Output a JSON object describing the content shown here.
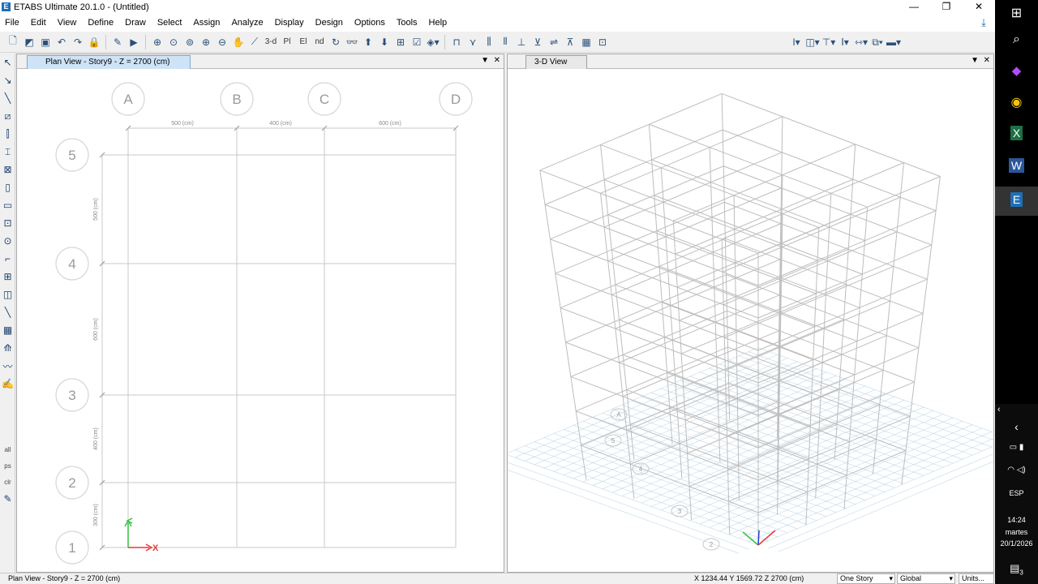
{
  "window": {
    "title": "ETABS Ultimate 20.1.0 - (Untitled)",
    "controls": [
      "—",
      "❐",
      "✕"
    ]
  },
  "menu": [
    "File",
    "Edit",
    "View",
    "Define",
    "Draw",
    "Select",
    "Assign",
    "Analyze",
    "Display",
    "Design",
    "Options",
    "Tools",
    "Help"
  ],
  "toolbar": {
    "view_3d_label": "3-d",
    "plan_label": "Pl",
    "elev_label": "El",
    "nd_label": "nd"
  },
  "plan_view": {
    "tab_title": "Plan View - Story9 - Z = 2700 (cm)",
    "grid_x": [
      "A",
      "B",
      "C",
      "D"
    ],
    "grid_y": [
      "5",
      "4",
      "3",
      "2",
      "1"
    ],
    "x_spacings": [
      "500 (cm)",
      "400 (cm)",
      "600 (cm)"
    ],
    "y_spacings": [
      "500 (cm)",
      "600 (cm)",
      "400 (cm)",
      "300 (cm)"
    ],
    "axis_x_label": "X"
  },
  "view_3d": {
    "tab_title": "3-D View",
    "bubbles": [
      "A",
      "5",
      "4",
      "3",
      "2"
    ]
  },
  "status": {
    "left": "Plan View - Story9 - Z = 2700 (cm)",
    "coords": "X 1234.44  Y 1569.72  Z 2700 (cm)",
    "story_sel": "One Story",
    "coord_sys": "Global",
    "units": "Units..."
  },
  "taskbar": {
    "lang": "ESP",
    "time": "14:24",
    "day": "martes",
    "date": "20/1/2026",
    "notif_count": "3"
  },
  "colors": {
    "grid_line": "#c8c8c8",
    "frame": "#bdbdbd",
    "base_grid": "#a9c9df",
    "axis_x": "#e23b3b",
    "axis_y": "#35c13e",
    "axis_z": "#1f3fd0"
  }
}
